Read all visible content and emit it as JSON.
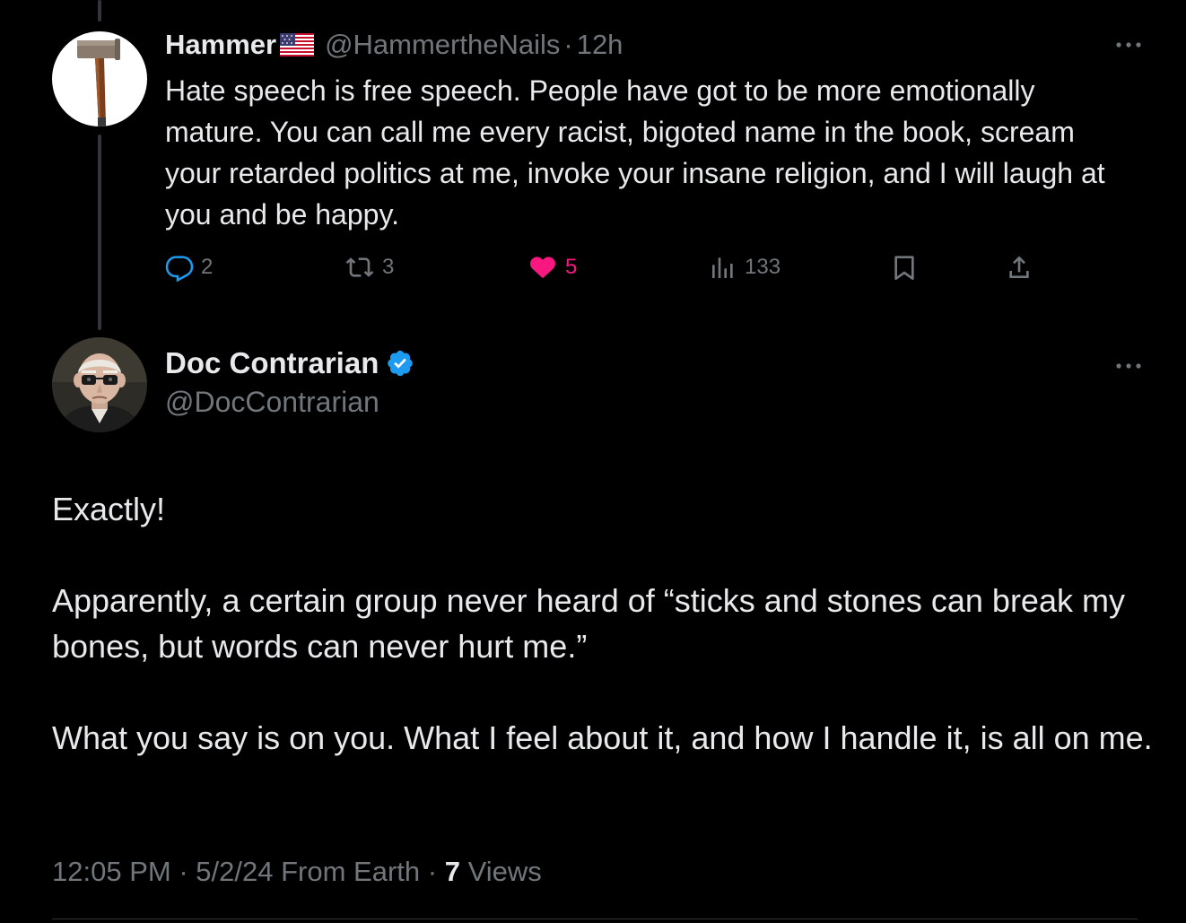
{
  "reply_tweet": {
    "author_name": "Hammer",
    "flag_icon": "us-flag-icon",
    "handle": "@HammertheNails",
    "separator": "·",
    "time_ago": "12h",
    "text": "Hate speech is free speech.  People have got to be more emotionally mature. You can call me every racist, bigoted name in the book, scream your retarded politics at me, invoke your insane religion, and I will laugh at you and be happy.",
    "actions": {
      "replies": "2",
      "reposts": "3",
      "likes": "5",
      "views": "133"
    },
    "like_color": "#f91880"
  },
  "main_tweet": {
    "author_name": "Doc Contrarian",
    "verified_color": "#1d9bf0",
    "handle": "@DocContrarian",
    "paragraphs": [
      "Exactly!",
      "Apparently, a certain group never heard of “sticks and stones can break my bones, but words can never hurt me.”",
      "What you say is on you. What I feel about it, and how I handle it, is all on me."
    ],
    "meta": {
      "time": "12:05 PM",
      "separator": "·",
      "date": "5/2/24",
      "source": "From Earth",
      "views_count": "7",
      "views_label": "Views"
    }
  },
  "colors": {
    "background": "#000000",
    "primary_text": "#e7e9ea",
    "secondary_text": "#71767b",
    "thread_line": "#333639"
  }
}
